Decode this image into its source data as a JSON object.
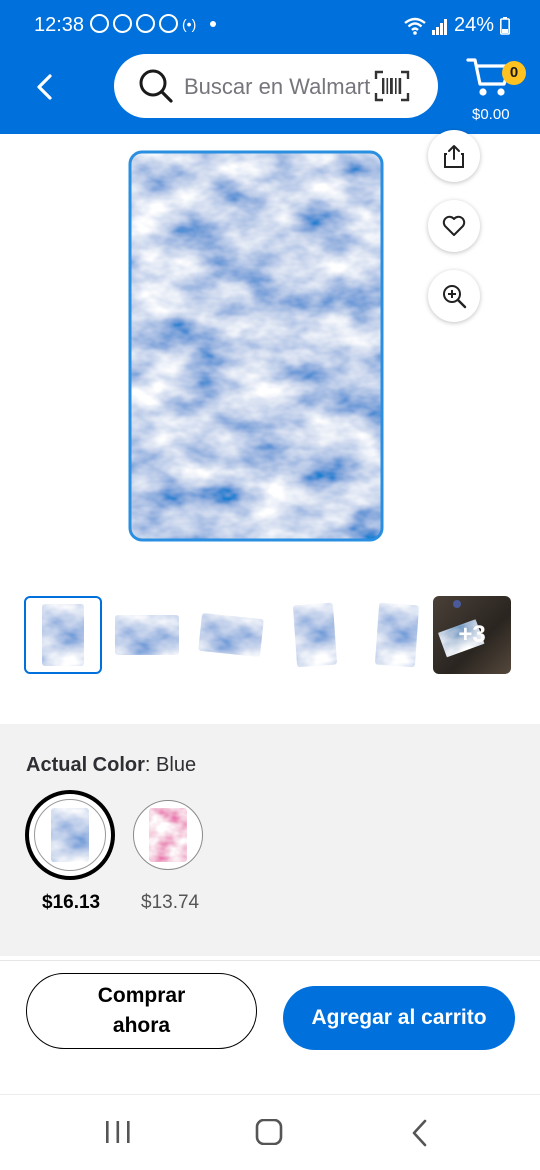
{
  "status_bar": {
    "time": "12:38",
    "battery": "24%"
  },
  "header": {
    "search_placeholder": "Buscar en Walmart",
    "cart_count": "0",
    "cart_total": "$0.00",
    "brand_color": "#0071dc",
    "badge_color": "#ffc220"
  },
  "gallery": {
    "more_label": "+3",
    "actions": [
      "share-icon",
      "heart-icon",
      "zoom-in-icon"
    ]
  },
  "variants": {
    "label": "Actual Color",
    "value": "Blue",
    "options": [
      {
        "price": "$16.13",
        "selected": true,
        "color": "blue"
      },
      {
        "price": "$13.74",
        "selected": false,
        "color": "pink"
      }
    ]
  },
  "buttons": {
    "buy_now": "Comprar ahora",
    "add_to_cart": "Agregar al carrito"
  }
}
